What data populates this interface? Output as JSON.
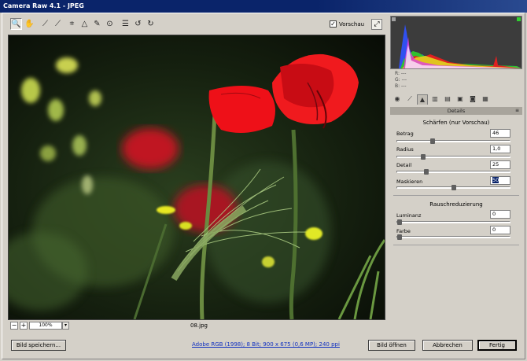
{
  "window": {
    "title": "Camera Raw 4.1 - JPEG"
  },
  "toolbar": {
    "tools": [
      {
        "name": "zoom-tool-icon",
        "glyph": "🔍"
      },
      {
        "name": "hand-tool-icon",
        "glyph": "✋"
      },
      {
        "name": "white-balance-tool-icon",
        "glyph": "⟋"
      },
      {
        "name": "color-sampler-tool-icon",
        "glyph": "⟋"
      },
      {
        "name": "crop-tool-icon",
        "glyph": "⌗"
      },
      {
        "name": "straighten-tool-icon",
        "glyph": "△"
      },
      {
        "name": "retouch-tool-icon",
        "glyph": "✎"
      },
      {
        "name": "red-eye-tool-icon",
        "glyph": "⊙"
      },
      {
        "name": "preferences-icon",
        "glyph": "☰"
      },
      {
        "name": "rotate-left-icon",
        "glyph": "↺"
      },
      {
        "name": "rotate-right-icon",
        "glyph": "↻"
      }
    ],
    "preview_label": "Vorschau",
    "preview_checked": "✓"
  },
  "image": {
    "filename": "08.jpg",
    "zoom": "100%"
  },
  "readout": {
    "r": "R:   ---",
    "g": "G:   ---",
    "b": "B:   ---"
  },
  "panel": {
    "header": "Details",
    "sharpening": {
      "title": "Schärfen (nur Vorschau)",
      "controls": [
        {
          "label": "Betrag",
          "value": "46",
          "fraction": 0.31
        },
        {
          "label": "Radius",
          "value": "1,0",
          "fraction": 0.22
        },
        {
          "label": "Detail",
          "value": "25",
          "fraction": 0.25
        },
        {
          "label": "Maskieren",
          "value": "50",
          "fraction": 0.5
        }
      ]
    },
    "noise": {
      "title": "Rauschreduzierung",
      "controls": [
        {
          "label": "Luminanz",
          "value": "0",
          "fraction": 0
        },
        {
          "label": "Farbe",
          "value": "0",
          "fraction": 0
        }
      ]
    }
  },
  "footer": {
    "save": "Bild speichern...",
    "workflow": "Adobe RGB (1998); 8 Bit; 900 x 675 (0,6 MP); 240 ppi",
    "open": "Bild öffnen",
    "cancel": "Abbrechen",
    "done": "Fertig"
  },
  "colors": {
    "title_bar": "#0a246a",
    "link": "#1030c0",
    "poppy": "#e8101a"
  }
}
